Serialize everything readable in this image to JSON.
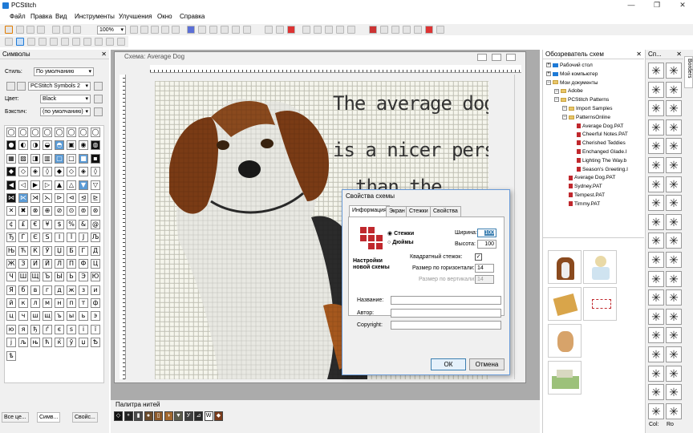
{
  "app": {
    "title": "PCStitch"
  },
  "menu": [
    "Файл",
    "Правка",
    "Вид",
    "Инструменты",
    "Улучшения",
    "Окно",
    "Справка"
  ],
  "toolbar": {
    "zoom": "100%"
  },
  "symbols_panel": {
    "title": "Символы",
    "style_label": "Стиль:",
    "style_value": "По умолчанию",
    "font_value": "PCStitch Symbols 2",
    "color_label": "Цвет:",
    "color_value": "Black",
    "backstitch_label": "Бэкстич:",
    "backstitch_value": "(по умолчанию)",
    "cells": [
      "◯",
      "◯",
      "◯",
      "◯",
      "◯",
      "◯",
      "◯",
      "◯",
      "●",
      "◐",
      "◑",
      "◒",
      "◓",
      "▣",
      "◉",
      "◍",
      "▦",
      "▨",
      "◨",
      "▥",
      "▢",
      "□",
      "■",
      "▪",
      "◆",
      "◇",
      "◈",
      "◊",
      "◆",
      "◇",
      "◈",
      "◊",
      "◀",
      "◁",
      "▶",
      "▷",
      "▲",
      "△",
      "▼",
      "▽",
      "⋈",
      "⋉",
      "⋊",
      "⋋",
      "⊳",
      "⊲",
      "⊴",
      "⊵",
      "✕",
      "✖",
      "⊗",
      "⊕",
      "⊘",
      "⊙",
      "⊚",
      "⊛",
      "¢",
      "£",
      "€",
      "¥",
      "$",
      "%",
      "&",
      "@",
      "Ђ",
      "Ѓ",
      "Є",
      "Ѕ",
      "І",
      "Ї",
      "Ј",
      "Љ",
      "Њ",
      "Ћ",
      "Ќ",
      "Ў",
      "Џ",
      "Б",
      "Г",
      "Д",
      "Ж",
      "З",
      "И",
      "Й",
      "Л",
      "П",
      "Ф",
      "Ц",
      "Ч",
      "Ш",
      "Щ",
      "Ъ",
      "Ы",
      "Ь",
      "Э",
      "Ю",
      "Я",
      "б",
      "в",
      "г",
      "д",
      "ж",
      "з",
      "и",
      "й",
      "к",
      "л",
      "м",
      "н",
      "п",
      "т",
      "ф",
      "ц",
      "ч",
      "ш",
      "щ",
      "ъ",
      "ы",
      "ь",
      "э",
      "ю",
      "я",
      "ђ",
      "ѓ",
      "є",
      "ѕ",
      "і",
      "ї",
      "ј",
      "љ",
      "њ",
      "ћ",
      "ќ",
      "ў",
      "џ",
      "Ѣ",
      "ѣ"
    ]
  },
  "document": {
    "title": "Схема: Average Dog",
    "chart_text_line1": "The average dog",
    "chart_text_line2": "is a nicer person",
    "chart_text_line3": "than the"
  },
  "dialog": {
    "title": "Свойства схемы",
    "tabs": [
      "Информация",
      "Экран",
      "Стежки",
      "Свойства"
    ],
    "radio_stitches": "Стежки",
    "radio_inches": "Дюймы",
    "width_label": "Ширина:",
    "width_value": "100",
    "height_label": "Высота:",
    "height_value": "100",
    "square_label": "Квадратный стежок:",
    "hsize_label": "Размер по горизонтали:",
    "hsize_value": "14",
    "vsize_label": "Размер по вертикали:",
    "vsize_value": "14",
    "setup_caption": "Настройки новой схемы",
    "name_label": "Название:",
    "author_label": "Автор:",
    "copyright_label": "Copyright:",
    "ok": "ОК",
    "cancel": "Отмена"
  },
  "palette": {
    "title": "Палитра нитей",
    "chips": [
      {
        "sym": "◇",
        "color": "#111111"
      },
      {
        "sym": "⚬",
        "color": "#222222"
      },
      {
        "sym": "▮",
        "color": "#4a4a4a"
      },
      {
        "sym": "●",
        "color": "#6b4c2c"
      },
      {
        "sym": "▯",
        "color": "#8d5a2b"
      },
      {
        "sym": "◑",
        "color": "#a2682f"
      },
      {
        "sym": "▼",
        "color": "#5b5b4c"
      },
      {
        "sym": "У",
        "color": "#3f3f3f"
      },
      {
        "sym": "⊿",
        "color": "#2a2a2a"
      },
      {
        "sym": "W",
        "color": "#ffffff"
      },
      {
        "sym": "◆",
        "color": "#7a3b1b"
      }
    ]
  },
  "browser": {
    "title": "Обозреватель схем",
    "items": [
      {
        "label": "Рабочий стол",
        "type": "pc",
        "indent": 0
      },
      {
        "label": "Мой компьютер",
        "type": "pc",
        "indent": 0
      },
      {
        "label": "Мои документы",
        "type": "folder",
        "indent": 0
      },
      {
        "label": "Adobe",
        "type": "folder",
        "indent": 1
      },
      {
        "label": "PCStitch Patterns",
        "type": "folder",
        "indent": 1
      },
      {
        "label": "Import Samples",
        "type": "folder",
        "indent": 2
      },
      {
        "label": "PatternsOnline",
        "type": "folder",
        "indent": 2
      },
      {
        "label": "Average Dog.PAT",
        "type": "pat",
        "indent": 3
      },
      {
        "label": "Cheerful Notes.PAT",
        "type": "pat",
        "indent": 3
      },
      {
        "label": "Cherished Teddies",
        "type": "pat",
        "indent": 3
      },
      {
        "label": "Enchanged Glade.I",
        "type": "pat",
        "indent": 3
      },
      {
        "label": "Lighting The Way.b",
        "type": "pat",
        "indent": 3
      },
      {
        "label": "Season's Greeting.I",
        "type": "pat",
        "indent": 3
      },
      {
        "label": "Average Dog.PAT",
        "type": "pat",
        "indent": 2
      },
      {
        "label": "Sydney.PAT",
        "type": "pat",
        "indent": 2
      },
      {
        "label": "Tempest.PAT",
        "type": "pat",
        "indent": 2
      },
      {
        "label": "Timmy.PAT",
        "type": "pat",
        "indent": 2
      }
    ]
  },
  "stitches_panel": {
    "title": "Сп...",
    "vtab": "Borders"
  },
  "status": {
    "left_tabs": [
      "Все це...",
      "Симв...",
      "Свойс..."
    ],
    "col": "Col:",
    "row": "Ro"
  }
}
